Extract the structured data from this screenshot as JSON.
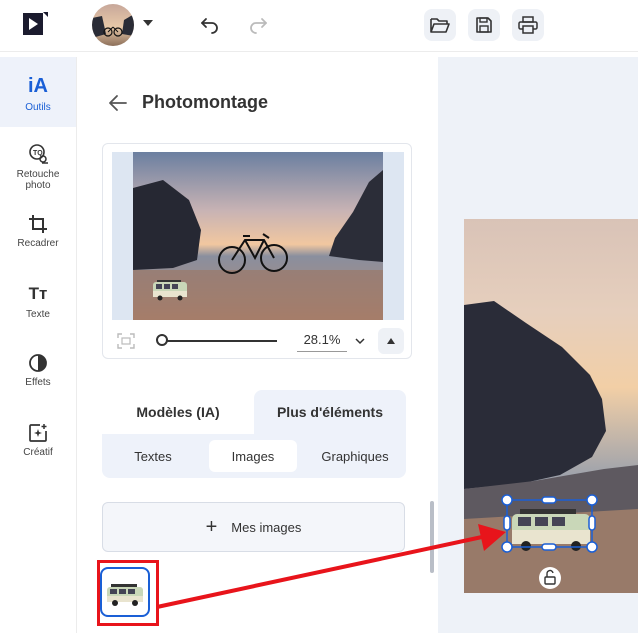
{
  "topbar": {
    "logo_icon": "logo-play-icon",
    "avatar_icon": "avatar-photo",
    "undo_icon": "undo-icon",
    "redo_icon": "redo-icon",
    "open_icon": "folder-open-icon",
    "save_icon": "save-icon",
    "print_icon": "print-icon"
  },
  "rail": {
    "items": [
      {
        "label": "Outils",
        "icon": "ai-text-icon",
        "glyph": "iA",
        "active": true
      },
      {
        "label": "Retouche photo",
        "icon": "retouch-icon",
        "active": false
      },
      {
        "label": "Recadrer",
        "icon": "crop-icon",
        "active": false
      },
      {
        "label": "Texte",
        "icon": "text-icon",
        "glyph": "Tт",
        "active": false
      },
      {
        "label": "Effets",
        "icon": "effects-icon",
        "active": false
      },
      {
        "label": "Créatif",
        "icon": "creative-icon",
        "active": false
      }
    ]
  },
  "panel": {
    "title": "Photomontage",
    "zoom_value": "28.1%",
    "tabs": [
      {
        "label": "Modèles (IA)",
        "active": false
      },
      {
        "label": "Plus d'éléments",
        "active": true
      }
    ],
    "subtabs": [
      {
        "label": "Textes",
        "active": false
      },
      {
        "label": "Images",
        "active": true
      },
      {
        "label": "Graphiques",
        "active": false
      }
    ],
    "mes_images_label": "Mes images",
    "plus_glyph": "+"
  },
  "colors": {
    "accent": "#1a5fd6",
    "highlight": "#e8141b",
    "panel_bg": "#eef2fa"
  }
}
